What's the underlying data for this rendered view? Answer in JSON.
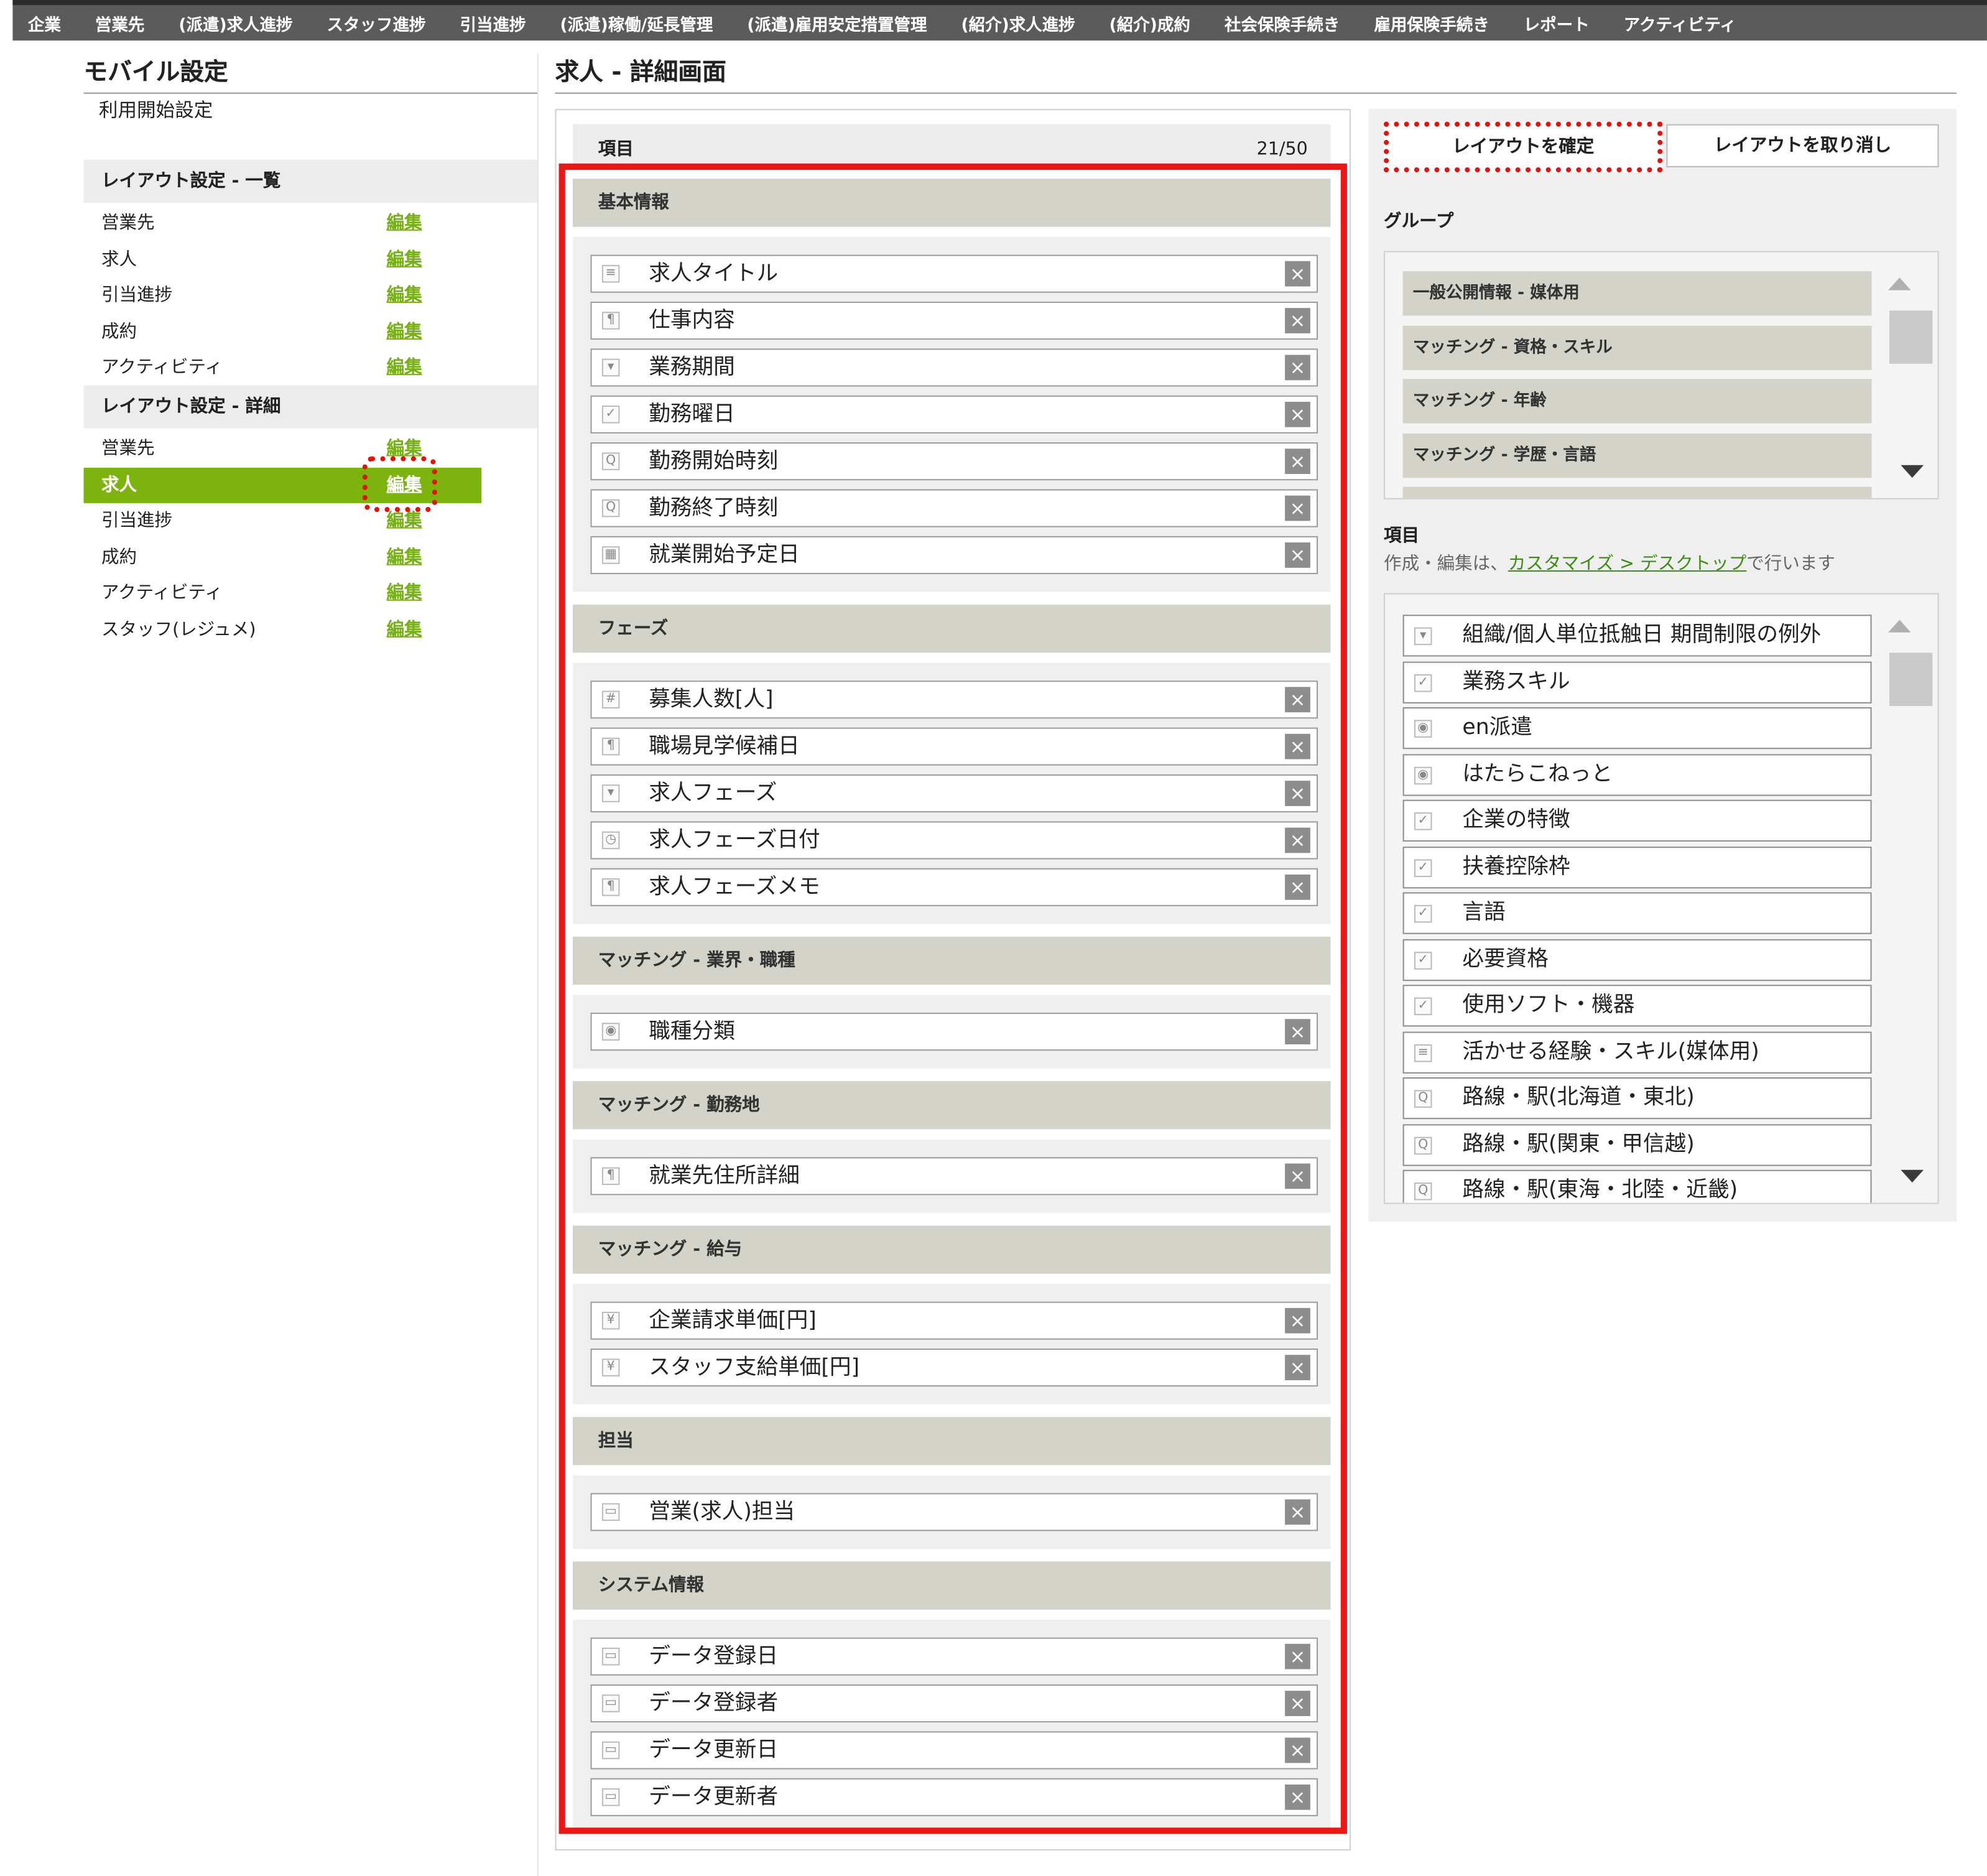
{
  "nav": [
    "企業",
    "営業先",
    "(派遣)求人進捗",
    "スタッフ進捗",
    "引当進捗",
    "(派遣)稼働/延長管理",
    "(派遣)雇用安定措置管理",
    "(紹介)求人進捗",
    "(紹介)成約",
    "社会保険手続き",
    "雇用保険手続き",
    "レポート",
    "アクティビティ"
  ],
  "sidebar": {
    "title": "モバイル設定",
    "start_setting": "利用開始設定",
    "list_section": "レイアウト設定 - 一覧",
    "list_items": [
      "営業先",
      "求人",
      "引当進捗",
      "成約",
      "アクティビティ"
    ],
    "detail_section": "レイアウト設定 - 詳細",
    "detail_items": [
      "営業先",
      "求人",
      "引当進捗",
      "成約",
      "アクティビティ",
      "スタッフ(レジュメ)"
    ],
    "edit_label": "編集",
    "active_item": "求人"
  },
  "main": {
    "title": "求人 - 詳細画面",
    "items_header": "項目",
    "items_count": "21/50"
  },
  "layout_groups": [
    {
      "name": "基本情報",
      "fields": [
        {
          "label": "求人タイトル",
          "icon": "text-icon"
        },
        {
          "label": "仕事内容",
          "icon": "textarea-icon"
        },
        {
          "label": "業務期間",
          "icon": "dropdown-icon"
        },
        {
          "label": "勤務曜日",
          "icon": "checkbox-icon"
        },
        {
          "label": "勤務開始時刻",
          "icon": "lookup-icon"
        },
        {
          "label": "勤務終了時刻",
          "icon": "lookup-icon"
        },
        {
          "label": "就業開始予定日",
          "icon": "calendar-icon"
        }
      ]
    },
    {
      "name": "フェーズ",
      "fields": [
        {
          "label": "募集人数[人]",
          "icon": "number-icon"
        },
        {
          "label": "職場見学候補日",
          "icon": "textarea-icon"
        },
        {
          "label": "求人フェーズ",
          "icon": "dropdown-icon"
        },
        {
          "label": "求人フェーズ日付",
          "icon": "clock-icon"
        },
        {
          "label": "求人フェーズメモ",
          "icon": "textarea-icon"
        }
      ]
    },
    {
      "name": "マッチング - 業界・職種",
      "fields": [
        {
          "label": "職種分類",
          "icon": "radio-icon"
        }
      ]
    },
    {
      "name": "マッチング - 勤務地",
      "fields": [
        {
          "label": "就業先住所詳細",
          "icon": "textarea-icon"
        }
      ]
    },
    {
      "name": "マッチング - 給与",
      "fields": [
        {
          "label": "企業請求単価[円]",
          "icon": "currency-icon"
        },
        {
          "label": "スタッフ支給単価[円]",
          "icon": "currency-icon"
        }
      ]
    },
    {
      "name": "担当",
      "fields": [
        {
          "label": "営業(求人)担当",
          "icon": "system-icon"
        }
      ]
    },
    {
      "name": "システム情報",
      "fields": [
        {
          "label": "データ登録日",
          "icon": "system-icon"
        },
        {
          "label": "データ登録者",
          "icon": "system-icon"
        },
        {
          "label": "データ更新日",
          "icon": "system-icon"
        },
        {
          "label": "データ更新者",
          "icon": "system-icon"
        }
      ]
    }
  ],
  "remove_glyph": "×",
  "actions": {
    "confirm": "レイアウトを確定",
    "cancel": "レイアウトを取り消し"
  },
  "groups_panel": {
    "label": "グループ",
    "items": [
      "一般公開情報 - 媒体用",
      "マッチング - 資格・スキル",
      "マッチング - 年齢",
      "マッチング - 学歴・言語"
    ]
  },
  "items_panel": {
    "label": "項目",
    "note_before": "作成・編集は、",
    "note_link": "カスタマイズ > デスクトップ",
    "note_after": "で行います",
    "items": [
      {
        "label": "組織/個人単位抵触日 期間制限の例外",
        "icon": "dropdown-icon"
      },
      {
        "label": "業務スキル",
        "icon": "checkbox-icon"
      },
      {
        "label": "en派遣",
        "icon": "radio-icon"
      },
      {
        "label": "はたらこねっと",
        "icon": "radio-icon"
      },
      {
        "label": "企業の特徴",
        "icon": "checkbox-icon"
      },
      {
        "label": "扶養控除枠",
        "icon": "checkbox-icon"
      },
      {
        "label": "言語",
        "icon": "checkbox-icon"
      },
      {
        "label": "必要資格",
        "icon": "checkbox-icon"
      },
      {
        "label": "使用ソフト・機器",
        "icon": "checkbox-icon"
      },
      {
        "label": "活かせる経験・スキル(媒体用)",
        "icon": "text-icon"
      },
      {
        "label": "路線・駅(北海道・東北)",
        "icon": "lookup-icon"
      },
      {
        "label": "路線・駅(関東・甲信越)",
        "icon": "lookup-icon"
      },
      {
        "label": "路線・駅(東海・北陸・近畿)",
        "icon": "lookup-icon"
      }
    ]
  },
  "colors": {
    "accent": "#7cb40d",
    "highlight": "#ee1515",
    "nav_bg": "#5b5b5b",
    "group_header": "#d3d3c9"
  }
}
